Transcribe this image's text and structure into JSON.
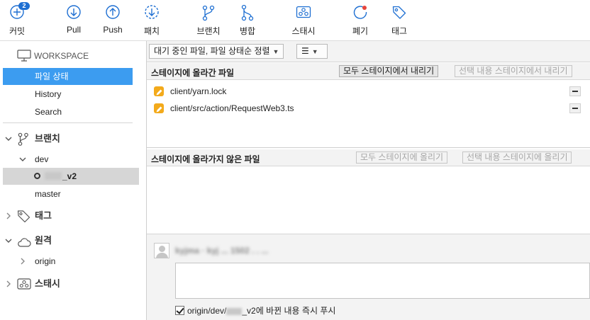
{
  "toolbar": {
    "commit": {
      "label": "커밋",
      "badge": "2"
    },
    "pull": {
      "label": "Pull"
    },
    "push": {
      "label": "Push"
    },
    "fetch": {
      "label": "패치"
    },
    "branch": {
      "label": "브랜치"
    },
    "merge": {
      "label": "병합"
    },
    "stash": {
      "label": "스태시"
    },
    "discard": {
      "label": "폐기"
    },
    "tag": {
      "label": "태그"
    }
  },
  "sidebar": {
    "workspace": {
      "label": "WORKSPACE",
      "items": [
        "파일 상태",
        "History",
        "Search"
      ]
    },
    "branches": {
      "label": "브랜치",
      "group": "dev",
      "current_branch": "_v2",
      "master": "master"
    },
    "tags": {
      "label": "태그"
    },
    "remotes": {
      "label": "원격",
      "origin": "origin"
    },
    "stashes": {
      "label": "스태시"
    }
  },
  "main": {
    "sort_dropdown": "대기 중인 파일, 파일 상태순 정렬",
    "view_dropdown": "☰",
    "staged": {
      "title": "스테이지에 올라간 파일",
      "unstage_all": "모두 스테이지에서 내리기",
      "unstage_selected": "선택 내용 스테이지에서 내리기",
      "files": [
        "client/yarn.lock",
        "client/src/action/RequestWeb3.ts"
      ]
    },
    "unstaged": {
      "title": "스테이지에 올라가지 않은 파일",
      "stage_all": "모두 스테이지에 올리기",
      "stage_selected": "선택 내용 스테이지에 올리기"
    },
    "commit": {
      "author": "kyjma  · kyj  ...  1502 .  . ...",
      "message": "",
      "push_label_prefix": "origin/dev/",
      "push_label_suffix": "_v2에 바뀐 내용 즉시 푸시",
      "push_checked": true
    }
  },
  "colors": {
    "accent": "#1e6fd2",
    "selection": "#3c9cf0",
    "modified": "#f3aa1b",
    "discard_dot": "#e8453c"
  }
}
